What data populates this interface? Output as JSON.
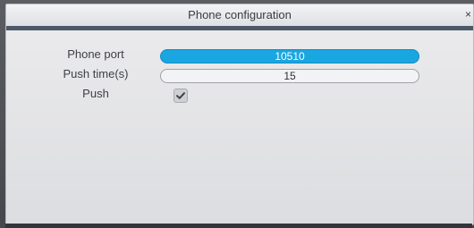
{
  "dialog": {
    "title": "Phone configuration",
    "close_symbol": "×"
  },
  "fields": {
    "phone_port": {
      "label": "Phone port",
      "value": "10510"
    },
    "push_time": {
      "label": "Push time(s)",
      "value": "15"
    },
    "push": {
      "label": "Push",
      "checked": true
    }
  },
  "colors": {
    "active_input": "#1aa6e0",
    "title_rule": "#4e5968"
  },
  "icons": {
    "close": "close-icon",
    "check": "checkmark-icon"
  }
}
